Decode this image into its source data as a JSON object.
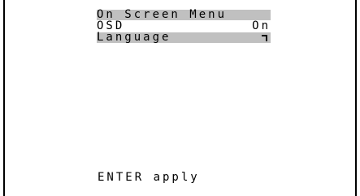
{
  "menu": {
    "title": "On Screen Menu",
    "items": [
      {
        "label": "OSD",
        "value": "On"
      },
      {
        "label": "Language",
        "icon": "submenu-arrow-icon"
      }
    ],
    "highlight_color": "#c0c0c0"
  },
  "footer": {
    "hint": "ENTER apply"
  }
}
